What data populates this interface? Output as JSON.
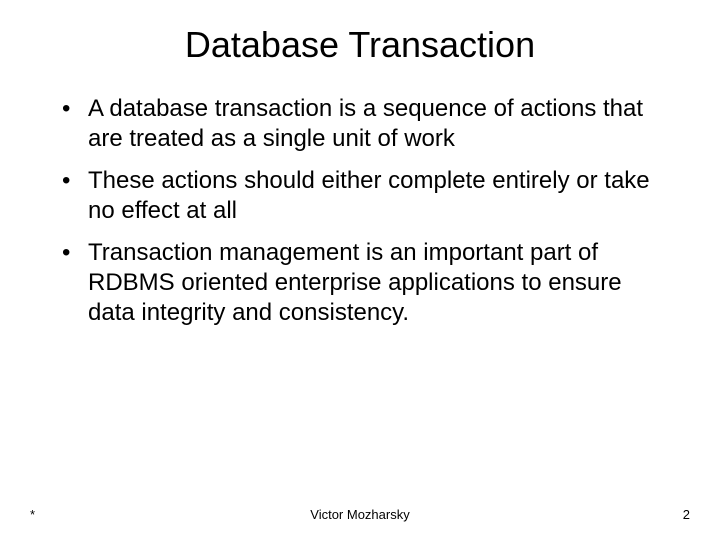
{
  "slide": {
    "title": "Database Transaction",
    "bullets": [
      "A database transaction is a sequence of actions that are treated as a single unit of work",
      "These actions should either complete entirely or take no effect at all",
      "Transaction management is an important part of RDBMS oriented enterprise applications to ensure data integrity and consistency."
    ]
  },
  "footer": {
    "left": "*",
    "center": "Victor Mozharsky",
    "right": "2"
  }
}
